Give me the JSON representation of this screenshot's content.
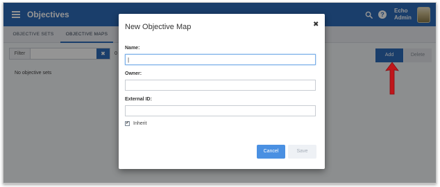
{
  "app": {
    "title": "Objectives",
    "user_line1": "Echo",
    "user_line2": "Admin"
  },
  "tabs": [
    {
      "label": "OBJECTIVE SETS",
      "active": false
    },
    {
      "label": "OBJECTIVE MAPS",
      "active": true
    }
  ],
  "filter": {
    "label": "Filter",
    "value": "",
    "clear_label": "✖",
    "truncated_text": "0"
  },
  "list": {
    "empty_message": "No objective sets"
  },
  "toolbar": {
    "add_label": "Add",
    "delete_label": "Delete"
  },
  "modal": {
    "title": "New Objective Map",
    "close_label": "✖",
    "name_label": "Name:",
    "name_value": "|",
    "owner_label": "Owner:",
    "owner_value": "",
    "external_id_label": "External ID:",
    "external_id_value": "",
    "inherit_label": "Inherit",
    "inherit_checked": true,
    "inherit_check_glyph": "✔",
    "cancel_label": "Cancel",
    "save_label": "Save"
  },
  "colors": {
    "appbar": "#2e6bb8",
    "accent": "#4a90e2",
    "arrow": "#c0161b"
  },
  "icons": [
    "menu-icon",
    "search-icon",
    "help-icon",
    "avatar",
    "close-icon",
    "arrow-annotation"
  ]
}
